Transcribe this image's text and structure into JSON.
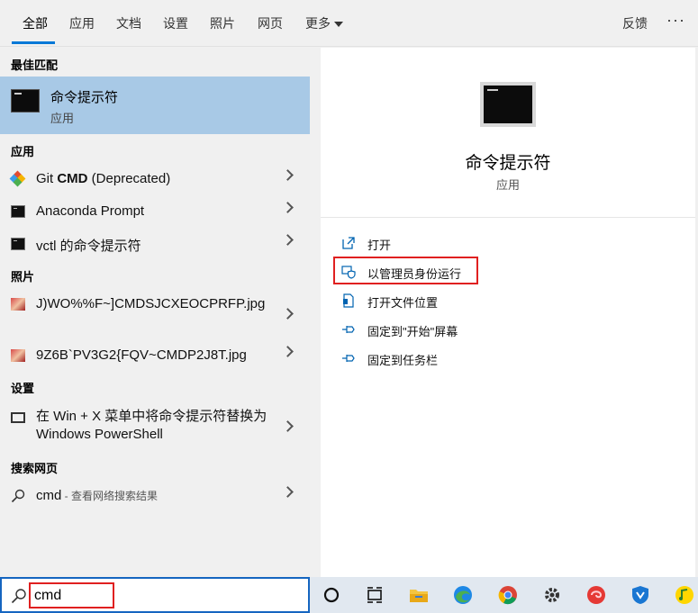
{
  "tabs": [
    "全部",
    "应用",
    "文档",
    "设置",
    "照片",
    "网页",
    "更多"
  ],
  "feedback_label": "反馈",
  "more_options": "···",
  "sections": {
    "best_match": "最佳匹配",
    "apps": "应用",
    "photos": "照片",
    "settings": "设置",
    "web": "搜索网页"
  },
  "best_match": {
    "title": "命令提示符",
    "subtitle": "应用"
  },
  "apps": [
    {
      "pre": "Git ",
      "bold": "CMD",
      "post": " (Deprecated)",
      "icon": "git-icon"
    },
    {
      "label": "Anaconda Prompt",
      "icon": "anaconda-prompt-icon"
    },
    {
      "label": "vctl 的命令提示符",
      "icon": "vctl-prompt-icon"
    }
  ],
  "photos": [
    {
      "label": "J)WO%%F~]CMDSJCXEOCPRFP.jpg",
      "icon": "image-icon"
    },
    {
      "label": "9Z6B`PV3G2{FQV~CMDP2J8T.jpg",
      "icon": "image-icon"
    }
  ],
  "settings": [
    {
      "label": "在 Win + X 菜单中将命令提示符替换为 Windows PowerShell",
      "icon": "settings-window-icon"
    }
  ],
  "web": {
    "query": "cmd",
    "suffix": " - 查看网络搜索结果",
    "icon": "search-icon"
  },
  "preview": {
    "title": "命令提示符",
    "subtitle": "应用"
  },
  "actions": [
    {
      "label": "打开",
      "icon": "open-icon"
    },
    {
      "label": "以管理员身份运行",
      "icon": "admin-shield-icon"
    },
    {
      "label": "打开文件位置",
      "icon": "file-location-icon"
    },
    {
      "label": "固定到\"开始\"屏幕",
      "icon": "pin-icon"
    },
    {
      "label": "固定到任务栏",
      "icon": "pin-icon"
    }
  ],
  "search": {
    "value": "cmd"
  },
  "taskbar_icons": [
    "cortana-icon",
    "task-view-icon",
    "file-explorer-icon",
    "edge-icon",
    "chrome-icon",
    "settings-gear-icon",
    "app-icon",
    "security-icon",
    "music-icon"
  ],
  "colors": {
    "accent": "#0078d7",
    "selection": "#a8c9e6",
    "highlight_box": "#e02020"
  }
}
